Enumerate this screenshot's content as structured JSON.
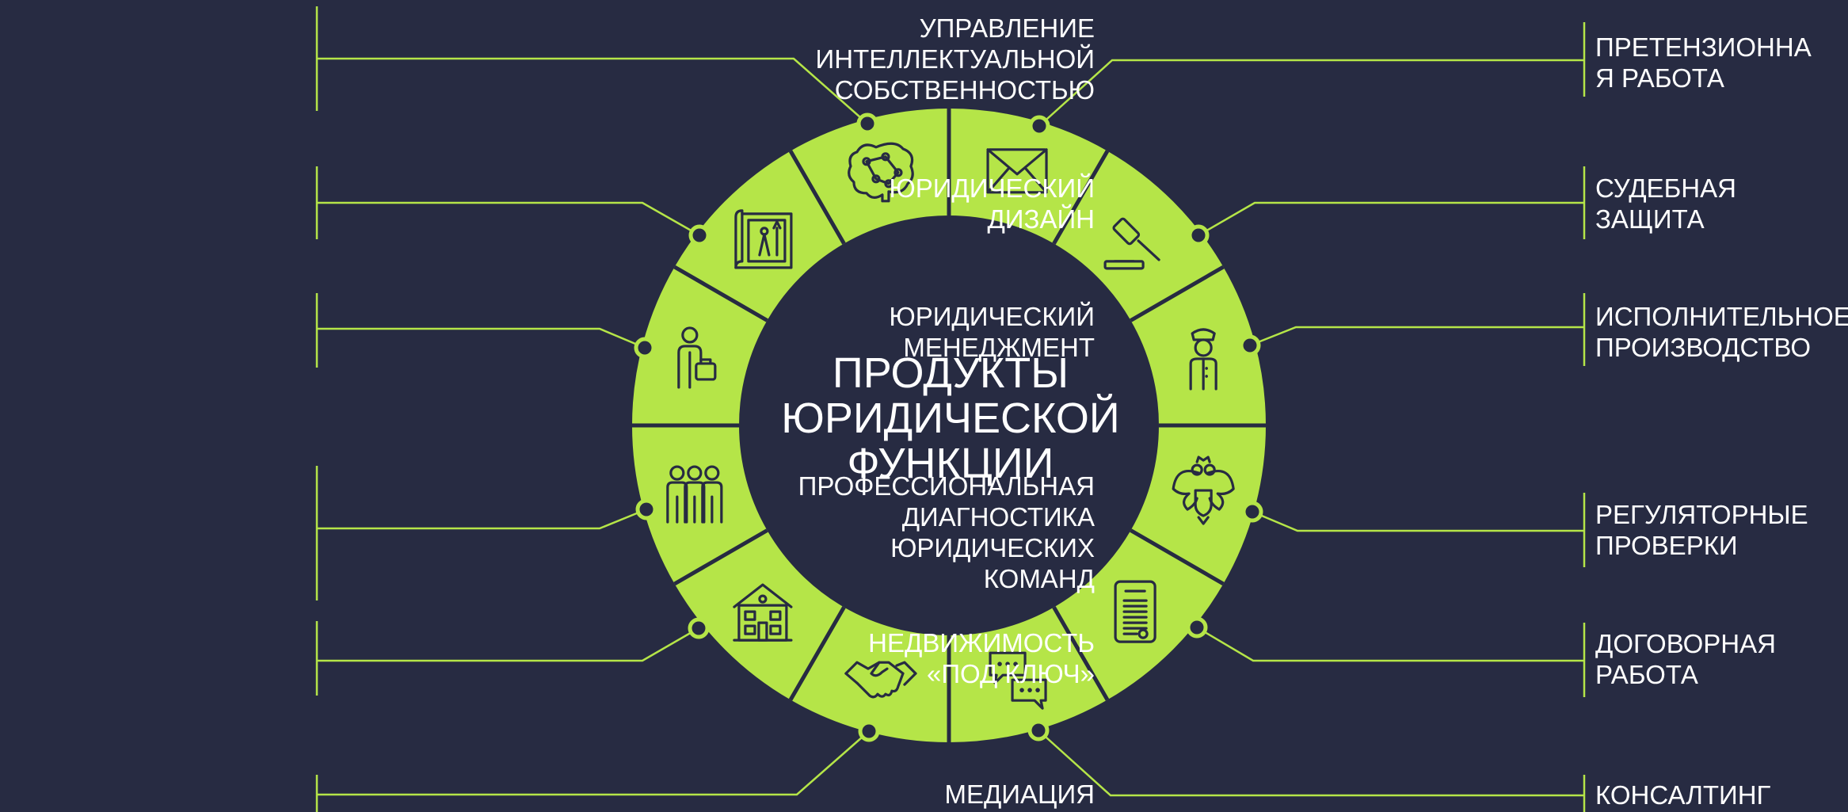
{
  "center_title": "ПРОДУКТЫ\nЮРИДИЧЕСКОЙ\nФУНКЦИИ",
  "colors": {
    "background": "#272b42",
    "ring": "#b5e548",
    "accent_line": "#b5e548",
    "icon": "#272b42",
    "text": "#ffffff"
  },
  "segments": [
    {
      "label": "ПРЕТЕНЗИОННА\nЯ РАБОТА",
      "icon": "envelope-icon"
    },
    {
      "label": "СУДЕБНАЯ\nЗАЩИТА",
      "icon": "gavel-icon"
    },
    {
      "label": "ИСПОЛНИТЕЛЬНОЕ\nПРОИЗВОДСТВО",
      "icon": "bailiff-icon"
    },
    {
      "label": "РЕГУЛЯТОРНЫЕ\nПРОВЕРКИ",
      "icon": "coat-of-arms-icon"
    },
    {
      "label": "ДОГОВОРНАЯ\nРАБОТА",
      "icon": "contract-document-icon"
    },
    {
      "label": "КОНСАЛТИНГ",
      "icon": "chat-bubbles-icon"
    },
    {
      "label": "МЕДИАЦИЯ",
      "icon": "handshake-icon"
    },
    {
      "label": "НЕДВИЖИМОСТЬ\n«ПОД КЛЮЧ»",
      "icon": "house-icon"
    },
    {
      "label": "ПРОФЕССИОНАЛЬНАЯ\nДИАГНОСТИКА\nЮРИДИЧЕСКИХ\nКОМАНД",
      "icon": "team-icon"
    },
    {
      "label": "ЮРИДИЧЕСКИЙ\nМЕНЕДЖМЕНТ",
      "icon": "manager-icon"
    },
    {
      "label": "ЮРИДИЧЕСКИЙ\nДИЗАЙН",
      "icon": "blueprint-icon"
    },
    {
      "label": "УПРАВЛЕНИЕ\nИНТЕЛЛЕКТУАЛЬНОЙ\nСОБСТВЕННОСТЬЮ",
      "icon": "brain-icon"
    }
  ]
}
